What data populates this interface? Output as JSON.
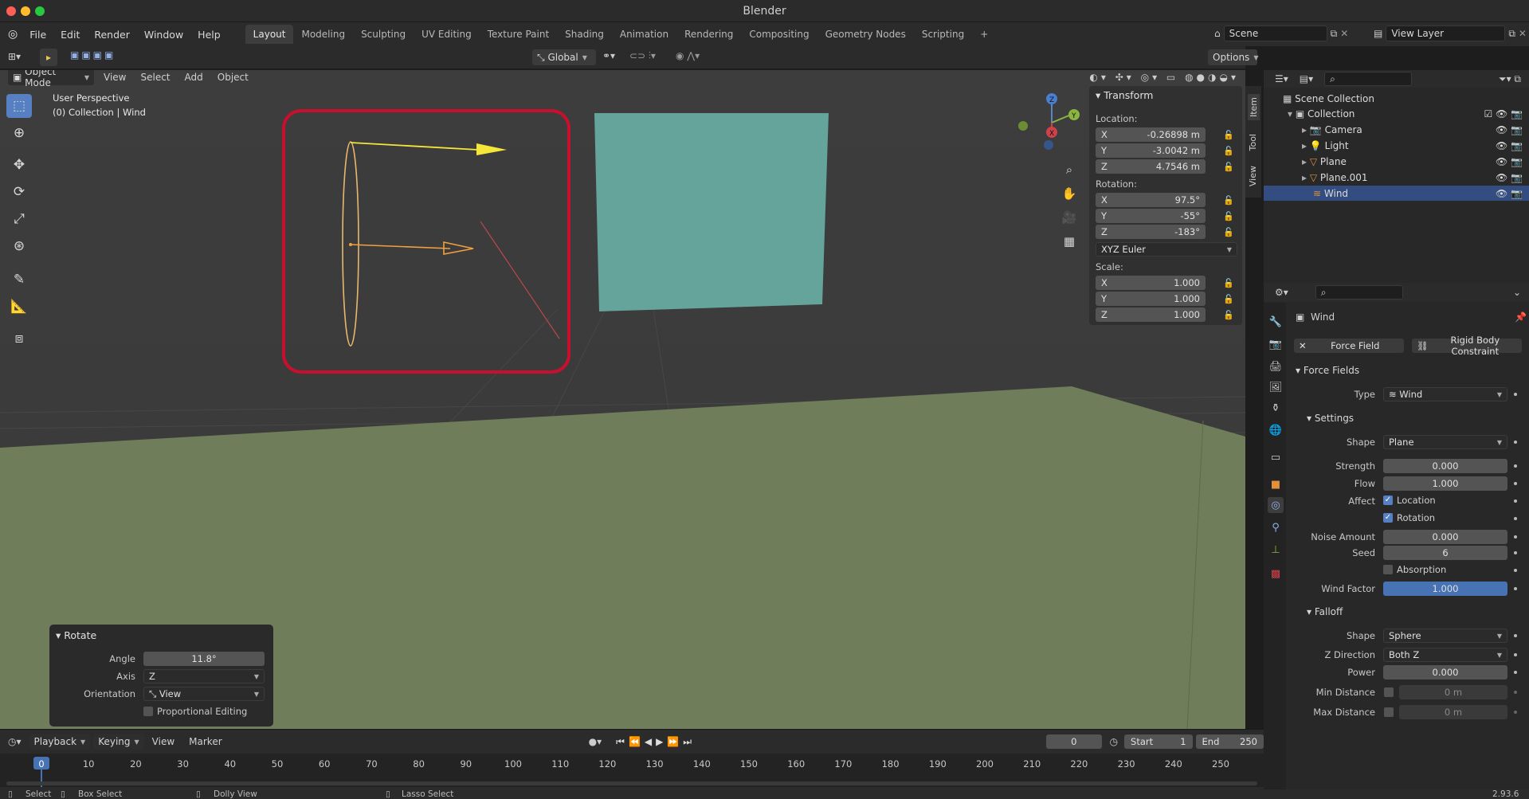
{
  "window": {
    "title": "Blender",
    "version": "2.93.6"
  },
  "topbar": {
    "menus": [
      "File",
      "Edit",
      "Render",
      "Window",
      "Help"
    ],
    "workspaces": [
      {
        "label": "Layout",
        "active": true
      },
      {
        "label": "Modeling"
      },
      {
        "label": "Sculpting"
      },
      {
        "label": "UV Editing"
      },
      {
        "label": "Texture Paint"
      },
      {
        "label": "Shading"
      },
      {
        "label": "Animation"
      },
      {
        "label": "Rendering"
      },
      {
        "label": "Compositing"
      },
      {
        "label": "Geometry Nodes"
      },
      {
        "label": "Scripting"
      }
    ],
    "add_tab": "+",
    "scene": "Scene",
    "view_layer": "View Layer"
  },
  "viewport_header": {
    "transform_orientation": "Global",
    "options": "Options",
    "mode": "Object Mode",
    "menus": [
      "View",
      "Select",
      "Add",
      "Object"
    ]
  },
  "viewport": {
    "perspective": "User Perspective",
    "collection_info": "(0) Collection | Wind",
    "gizmo_axes": {
      "x": "X",
      "y": "Y",
      "z": "Z"
    }
  },
  "npanel": {
    "title": "Transform",
    "location_label": "Location:",
    "location": [
      {
        "axis": "X",
        "value": "-0.26898 m"
      },
      {
        "axis": "Y",
        "value": "-3.0042 m"
      },
      {
        "axis": "Z",
        "value": "4.7546 m"
      }
    ],
    "rotation_label": "Rotation:",
    "rotation": [
      {
        "axis": "X",
        "value": "97.5°"
      },
      {
        "axis": "Y",
        "value": "-55°"
      },
      {
        "axis": "Z",
        "value": "-183°"
      }
    ],
    "rotation_mode": "XYZ Euler",
    "scale_label": "Scale:",
    "scale": [
      {
        "axis": "X",
        "value": "1.000"
      },
      {
        "axis": "Y",
        "value": "1.000"
      },
      {
        "axis": "Z",
        "value": "1.000"
      }
    ],
    "tabs": [
      "Item",
      "Tool",
      "View"
    ]
  },
  "redo_panel": {
    "title": "Rotate",
    "angle_label": "Angle",
    "angle": "11.8°",
    "axis_label": "Axis",
    "axis": "Z",
    "orientation_label": "Orientation",
    "orientation": "View",
    "proportional": "Proportional Editing"
  },
  "outliner": {
    "root": "Scene Collection",
    "collection": "Collection",
    "items": [
      {
        "name": "Camera",
        "selected": false
      },
      {
        "name": "Light",
        "selected": false
      },
      {
        "name": "Plane",
        "selected": false
      },
      {
        "name": "Plane.001",
        "selected": false
      },
      {
        "name": "Wind",
        "selected": true
      }
    ]
  },
  "properties": {
    "object_name": "Wind",
    "force_field_btn": "Force Field",
    "rigid_body_btn": "Rigid Body Constraint",
    "section_force_fields": "Force Fields",
    "type_label": "Type",
    "type": "Wind",
    "section_settings": "Settings",
    "shape_label": "Shape",
    "shape": "Plane",
    "strength_label": "Strength",
    "strength": "0.000",
    "flow_label": "Flow",
    "flow": "1.000",
    "affect_label": "Affect",
    "affect_location": "Location",
    "affect_rotation": "Rotation",
    "noise_label": "Noise Amount",
    "noise": "0.000",
    "seed_label": "Seed",
    "seed": "6",
    "absorption": "Absorption",
    "wind_factor_label": "Wind Factor",
    "wind_factor": "1.000",
    "section_falloff": "Falloff",
    "falloff_shape_label": "Shape",
    "falloff_shape": "Sphere",
    "zdir_label": "Z Direction",
    "zdir": "Both Z",
    "power_label": "Power",
    "power": "0.000",
    "min_dist_label": "Min Distance",
    "min_dist": "0 m",
    "max_dist_label": "Max Distance",
    "max_dist": "0 m"
  },
  "timeline": {
    "menus": [
      "Playback",
      "Keying",
      "View",
      "Marker"
    ],
    "current_frame": "0",
    "start_label": "Start",
    "start": "1",
    "end_label": "End",
    "end": "250",
    "ticks": [
      "0",
      "10",
      "20",
      "30",
      "40",
      "50",
      "60",
      "70",
      "80",
      "90",
      "100",
      "110",
      "120",
      "130",
      "140",
      "150",
      "160",
      "170",
      "180",
      "190",
      "200",
      "210",
      "220",
      "230",
      "240",
      "250"
    ]
  },
  "statusbar": {
    "select": "Select",
    "box_select": "Box Select",
    "dolly": "Dolly View",
    "lasso": "Lasso Select"
  },
  "colors": {
    "accent": "#5680c2",
    "selection": "#334d80",
    "highlight_frame": "#c8102e",
    "wind_arrow": "#f5e63a",
    "plane": "#64a49a",
    "ground": "#6f7d5a"
  }
}
